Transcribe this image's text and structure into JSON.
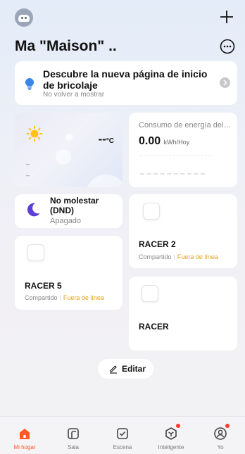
{
  "header": {
    "home_title": "Ma \"Maison\" ..",
    "add_label": "+"
  },
  "banner": {
    "title": "Descubre la nueva página de inicio de bricolaje",
    "subtitle": "No volver a mostrar"
  },
  "weather": {
    "temperature": "--",
    "unit": "°C",
    "line1": "–",
    "line2": "–"
  },
  "energy": {
    "title": "Consumo de energía del ...",
    "value": "0.00",
    "unit": "kWh/Hoy"
  },
  "dnd": {
    "title": "No molestar (DND)",
    "status": "Apagado"
  },
  "devices": [
    {
      "name": "RACER 2",
      "shared": "Compartido",
      "status": "Fuera de línea"
    },
    {
      "name": "RACER 5",
      "shared": "Compartido",
      "status": "Fuera de línea"
    },
    {
      "name": "RACER"
    }
  ],
  "edit_label": "Editar",
  "tabs": [
    {
      "label": "Mi hogar",
      "icon": "home-icon",
      "active": true
    },
    {
      "label": "Sala",
      "icon": "room-icon"
    },
    {
      "label": "Escena",
      "icon": "scene-icon"
    },
    {
      "label": "Inteligente",
      "icon": "smart-icon"
    },
    {
      "label": "Yo",
      "icon": "profile-icon"
    }
  ],
  "colors": {
    "accent": "#ff5a24",
    "offline": "#e6a21b",
    "notification_dot": "#ff3b30",
    "dnd_moon": "#5b3fd8",
    "bulb": "#3a86e8",
    "sun": "#ffc21a"
  }
}
